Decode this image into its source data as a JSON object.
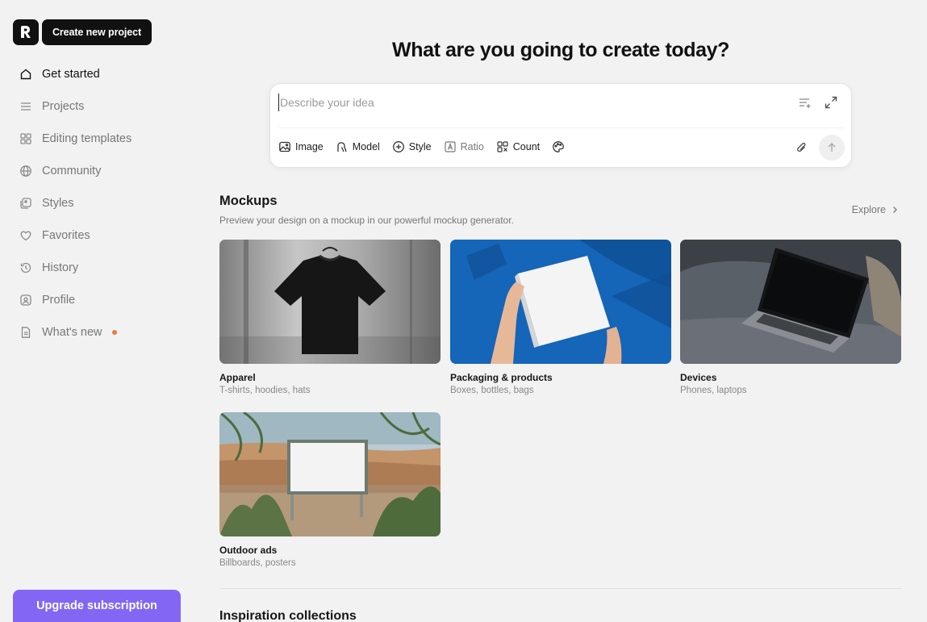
{
  "sidebar": {
    "create_button": "Create new project",
    "items": [
      {
        "label": "Get started",
        "icon": "home-icon",
        "active": true
      },
      {
        "label": "Projects",
        "icon": "list-icon"
      },
      {
        "label": "Editing templates",
        "icon": "grid-icon"
      },
      {
        "label": "Community",
        "icon": "globe-icon"
      },
      {
        "label": "Styles",
        "icon": "styles-icon"
      },
      {
        "label": "Favorites",
        "icon": "heart-icon"
      },
      {
        "label": "History",
        "icon": "history-icon"
      },
      {
        "label": "Profile",
        "icon": "profile-icon"
      },
      {
        "label": "What's new",
        "icon": "document-icon",
        "badge_color": "#ee7a3a"
      }
    ],
    "upgrade_button": "Upgrade subscription"
  },
  "main": {
    "headline": "What are you going to create today?",
    "prompt": {
      "placeholder": "Describe your idea",
      "options": [
        {
          "label": "Image",
          "icon": "image-icon"
        },
        {
          "label": "Model",
          "icon": "model-icon"
        },
        {
          "label": "Style",
          "icon": "plus-circle-icon"
        },
        {
          "label": "Ratio",
          "icon": "ratio-icon"
        },
        {
          "label": "Count",
          "icon": "count-icon"
        }
      ]
    },
    "mockups": {
      "title": "Mockups",
      "description": "Preview your design on a mockup in our powerful mockup generator.",
      "explore": "Explore",
      "cards": [
        {
          "title": "Apparel",
          "subtitle": "T-shirts, hoodies, hats"
        },
        {
          "title": "Packaging & products",
          "subtitle": "Boxes, bottles, bags"
        },
        {
          "title": "Devices",
          "subtitle": "Phones, laptops"
        },
        {
          "title": "Outdoor ads",
          "subtitle": "Billboards, posters"
        }
      ]
    },
    "inspiration": {
      "title": "Inspiration collections"
    }
  },
  "colors": {
    "accent": "#8466f5",
    "dark": "#111111",
    "badge": "#ee7a3a",
    "background": "#f2f2f2"
  }
}
